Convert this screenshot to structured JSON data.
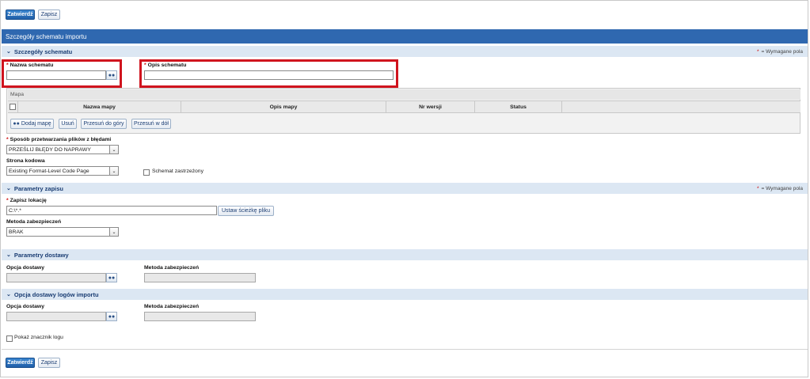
{
  "toolbar": {
    "submit_label": "Zatwierdź",
    "save_label": "Zapisz"
  },
  "page": {
    "title": "Szczegóły schematu importu"
  },
  "required_note": "= Wymagane pola",
  "required_star": "*",
  "section_schema": {
    "title": "Szczegóły schematu",
    "name_label": "Nazwa schematu",
    "name_value": "",
    "desc_label": "Opis schematu",
    "desc_value": ""
  },
  "map": {
    "title": "Mapa",
    "columns": [
      "Nazwa mapy",
      "Opis mapy",
      "Nr wersji",
      "Status"
    ],
    "buttons": {
      "add": "Dodaj mapę",
      "remove": "Usuń",
      "move_up": "Przesuń do góry",
      "move_down": "Przesuń w dół"
    }
  },
  "error_processing": {
    "label": "Sposób przetwarzania plików z błędami",
    "value": "PRZEŚLIJ BŁĘDY DO NAPRAWY"
  },
  "code_page": {
    "label": "Strona kodowa",
    "value": "Existing Format-Level Code Page",
    "restricted_label": "Schemat zastrzeżony",
    "restricted_checked": false
  },
  "section_save": {
    "title": "Parametry zapisu",
    "location_label": "Zapisz lokację",
    "location_value": "C:\\*.*",
    "set_path_label": "Ustaw ścieżkę pliku",
    "security_label": "Metoda zabezpieczeń",
    "security_value": "BRAK"
  },
  "section_delivery": {
    "title": "Parametry dostawy",
    "option_label": "Opcja dostawy",
    "security_label": "Metoda zabezpieczeń"
  },
  "section_log_delivery": {
    "title": "Opcja dostawy logów importu",
    "option_label": "Opcja dostawy",
    "security_label": "Metoda zabezpieczeń"
  },
  "show_log_marker": {
    "label": "Pokaż znacznik logu",
    "checked": false
  },
  "icons": {
    "lookup": "binoculars-icon",
    "chevron": "chevron-down-icon",
    "select_arrow": "dropdown-arrow-icon"
  },
  "colors": {
    "header": "#2f68b0",
    "section_bar": "#dce7f3",
    "highlight": "#d0141e",
    "required": "#cc0000"
  }
}
